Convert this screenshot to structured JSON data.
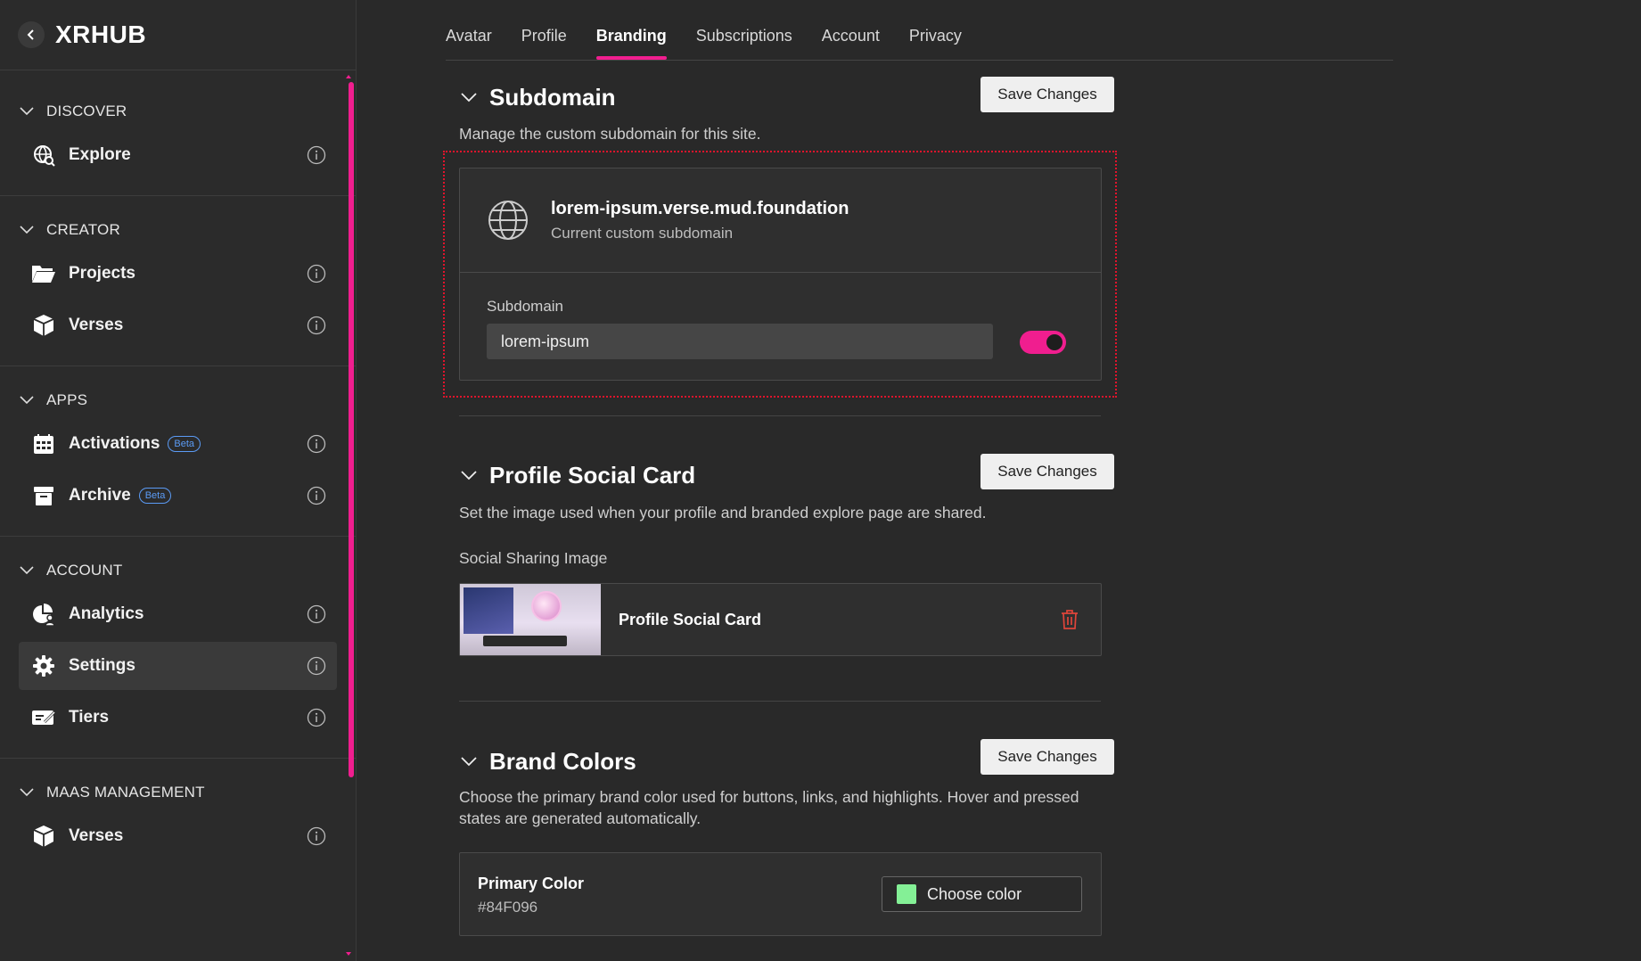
{
  "app": {
    "brand": "XRHUB"
  },
  "sidebar": {
    "sections": [
      {
        "title": "DISCOVER",
        "items": [
          {
            "label": "Explore"
          }
        ]
      },
      {
        "title": "CREATOR",
        "items": [
          {
            "label": "Projects"
          },
          {
            "label": "Verses"
          }
        ]
      },
      {
        "title": "APPS",
        "items": [
          {
            "label": "Activations",
            "badge": "Beta"
          },
          {
            "label": "Archive",
            "badge": "Beta"
          }
        ]
      },
      {
        "title": "ACCOUNT",
        "items": [
          {
            "label": "Analytics"
          },
          {
            "label": "Settings",
            "active": true
          },
          {
            "label": "Tiers"
          }
        ]
      },
      {
        "title": "MAAS MANAGEMENT",
        "items": [
          {
            "label": "Verses"
          }
        ]
      }
    ]
  },
  "tabs": [
    "Avatar",
    "Profile",
    "Branding",
    "Subscriptions",
    "Account",
    "Privacy"
  ],
  "active_tab": "Branding",
  "subdomain": {
    "title": "Subdomain",
    "description": "Manage the custom subdomain for this site.",
    "save_label": "Save Changes",
    "current_domain": "lorem-ipsum.verse.mud.foundation",
    "current_caption": "Current custom subdomain",
    "field_label": "Subdomain",
    "field_value": "lorem-ipsum",
    "toggle_on": true
  },
  "social_card": {
    "title": "Profile Social Card",
    "description": "Set the image used when your profile and branded explore page are shared.",
    "save_label": "Save Changes",
    "image_label": "Social Sharing Image",
    "image_title": "Profile Social Card"
  },
  "brand_colors": {
    "title": "Brand Colors",
    "description": "Choose the primary brand color used for buttons, links, and highlights. Hover and pressed states are generated automatically.",
    "save_label": "Save Changes",
    "primary_label": "Primary Color",
    "primary_hex": "#84F096",
    "choose_label": "Choose color"
  },
  "colors": {
    "accent": "#F01E8F",
    "highlight_border": "#E0142C",
    "beta_badge": "#5B9BF5",
    "delete": "#E0453A"
  }
}
